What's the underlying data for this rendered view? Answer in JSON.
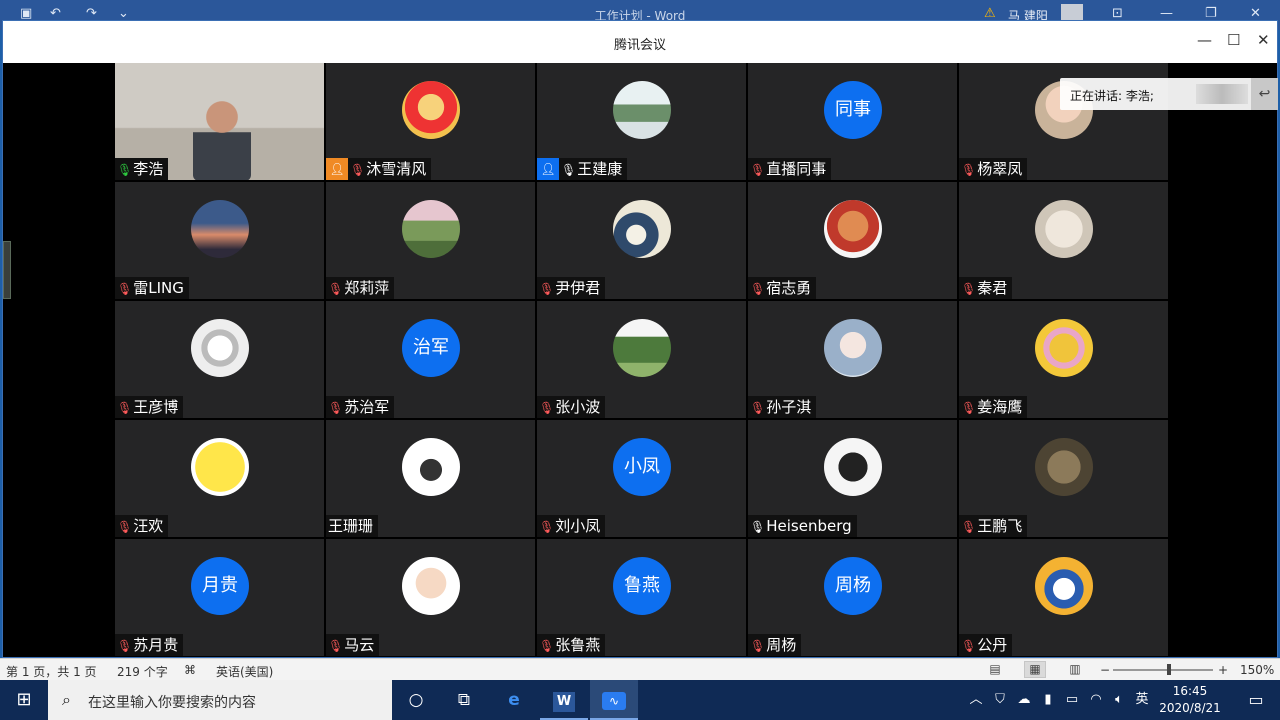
{
  "word": {
    "title": "工作计划 - Word",
    "user": "马 建阳",
    "status_page": "第 1 页，共 1 页",
    "status_words": "219 个字",
    "status_lang": "英语(美国)",
    "zoom": "150%"
  },
  "meeting": {
    "title": "腾讯会议",
    "speaking_label": "正在讲话: 李浩;",
    "participants": [
      {
        "name": "李浩",
        "mic": "on",
        "avatar": "video"
      },
      {
        "name": "沐雪清风",
        "mic": "muted",
        "avatar": "monkey-king",
        "badge": "orange"
      },
      {
        "name": "王建康",
        "mic": "unmuted",
        "avatar": "waterfall",
        "badge": "blue"
      },
      {
        "name": "直播同事",
        "mic": "muted",
        "avatar_text": "同事"
      },
      {
        "name": "杨翠凤",
        "mic": "muted",
        "avatar": "baby"
      },
      {
        "name": "雷LING",
        "mic": "muted",
        "avatar": "sunset"
      },
      {
        "name": "郑莉萍",
        "mic": "muted",
        "avatar": "park"
      },
      {
        "name": "尹伊君",
        "mic": "muted",
        "avatar": "great-wave"
      },
      {
        "name": "宿志勇",
        "mic": "muted",
        "avatar": "cartoon"
      },
      {
        "name": "秦君",
        "mic": "muted",
        "avatar": "plush"
      },
      {
        "name": "王彦博",
        "mic": "muted",
        "avatar": "astronaut"
      },
      {
        "name": "苏治军",
        "mic": "muted",
        "avatar_text": "治军"
      },
      {
        "name": "张小波",
        "mic": "muted",
        "avatar": "umbrella"
      },
      {
        "name": "孙子淇",
        "mic": "muted",
        "avatar": "anime"
      },
      {
        "name": "姜海鹰",
        "mic": "muted",
        "avatar": "fu"
      },
      {
        "name": "汪欢",
        "mic": "muted",
        "avatar": "sun-face"
      },
      {
        "name": "王珊珊",
        "mic": "none",
        "avatar": "cat"
      },
      {
        "name": "刘小凤",
        "mic": "muted",
        "avatar_text": "小凤"
      },
      {
        "name": "Heisenberg",
        "mic": "unmuted",
        "avatar": "heisenberg"
      },
      {
        "name": "王鹏飞",
        "mic": "muted",
        "avatar": "tabby"
      },
      {
        "name": "苏月贵",
        "mic": "muted",
        "avatar_text": "月贵"
      },
      {
        "name": "马云",
        "mic": "muted",
        "avatar": "kid"
      },
      {
        "name": "张鲁燕",
        "mic": "muted",
        "avatar_text": "鲁燕"
      },
      {
        "name": "周杨",
        "mic": "muted",
        "avatar_text": "周杨"
      },
      {
        "name": "公丹",
        "mic": "muted",
        "avatar": "donald"
      }
    ]
  },
  "taskbar": {
    "search_placeholder": "在这里输入你要搜索的内容",
    "time": "16:45",
    "date": "2020/8/21",
    "ime": "英"
  }
}
